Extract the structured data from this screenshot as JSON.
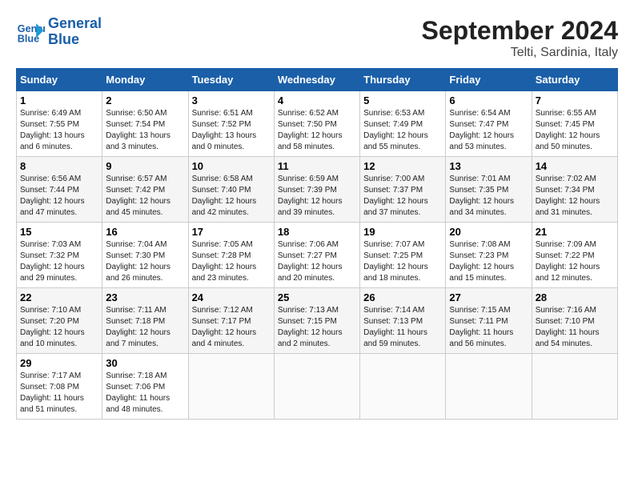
{
  "header": {
    "logo_line1": "General",
    "logo_line2": "Blue",
    "month": "September 2024",
    "location": "Telti, Sardinia, Italy"
  },
  "columns": [
    "Sunday",
    "Monday",
    "Tuesday",
    "Wednesday",
    "Thursday",
    "Friday",
    "Saturday"
  ],
  "weeks": [
    [
      {
        "day": "1",
        "sunrise": "Sunrise: 6:49 AM",
        "sunset": "Sunset: 7:55 PM",
        "daylight": "Daylight: 13 hours and 6 minutes."
      },
      {
        "day": "2",
        "sunrise": "Sunrise: 6:50 AM",
        "sunset": "Sunset: 7:54 PM",
        "daylight": "Daylight: 13 hours and 3 minutes."
      },
      {
        "day": "3",
        "sunrise": "Sunrise: 6:51 AM",
        "sunset": "Sunset: 7:52 PM",
        "daylight": "Daylight: 13 hours and 0 minutes."
      },
      {
        "day": "4",
        "sunrise": "Sunrise: 6:52 AM",
        "sunset": "Sunset: 7:50 PM",
        "daylight": "Daylight: 12 hours and 58 minutes."
      },
      {
        "day": "5",
        "sunrise": "Sunrise: 6:53 AM",
        "sunset": "Sunset: 7:49 PM",
        "daylight": "Daylight: 12 hours and 55 minutes."
      },
      {
        "day": "6",
        "sunrise": "Sunrise: 6:54 AM",
        "sunset": "Sunset: 7:47 PM",
        "daylight": "Daylight: 12 hours and 53 minutes."
      },
      {
        "day": "7",
        "sunrise": "Sunrise: 6:55 AM",
        "sunset": "Sunset: 7:45 PM",
        "daylight": "Daylight: 12 hours and 50 minutes."
      }
    ],
    [
      {
        "day": "8",
        "sunrise": "Sunrise: 6:56 AM",
        "sunset": "Sunset: 7:44 PM",
        "daylight": "Daylight: 12 hours and 47 minutes."
      },
      {
        "day": "9",
        "sunrise": "Sunrise: 6:57 AM",
        "sunset": "Sunset: 7:42 PM",
        "daylight": "Daylight: 12 hours and 45 minutes."
      },
      {
        "day": "10",
        "sunrise": "Sunrise: 6:58 AM",
        "sunset": "Sunset: 7:40 PM",
        "daylight": "Daylight: 12 hours and 42 minutes."
      },
      {
        "day": "11",
        "sunrise": "Sunrise: 6:59 AM",
        "sunset": "Sunset: 7:39 PM",
        "daylight": "Daylight: 12 hours and 39 minutes."
      },
      {
        "day": "12",
        "sunrise": "Sunrise: 7:00 AM",
        "sunset": "Sunset: 7:37 PM",
        "daylight": "Daylight: 12 hours and 37 minutes."
      },
      {
        "day": "13",
        "sunrise": "Sunrise: 7:01 AM",
        "sunset": "Sunset: 7:35 PM",
        "daylight": "Daylight: 12 hours and 34 minutes."
      },
      {
        "day": "14",
        "sunrise": "Sunrise: 7:02 AM",
        "sunset": "Sunset: 7:34 PM",
        "daylight": "Daylight: 12 hours and 31 minutes."
      }
    ],
    [
      {
        "day": "15",
        "sunrise": "Sunrise: 7:03 AM",
        "sunset": "Sunset: 7:32 PM",
        "daylight": "Daylight: 12 hours and 29 minutes."
      },
      {
        "day": "16",
        "sunrise": "Sunrise: 7:04 AM",
        "sunset": "Sunset: 7:30 PM",
        "daylight": "Daylight: 12 hours and 26 minutes."
      },
      {
        "day": "17",
        "sunrise": "Sunrise: 7:05 AM",
        "sunset": "Sunset: 7:28 PM",
        "daylight": "Daylight: 12 hours and 23 minutes."
      },
      {
        "day": "18",
        "sunrise": "Sunrise: 7:06 AM",
        "sunset": "Sunset: 7:27 PM",
        "daylight": "Daylight: 12 hours and 20 minutes."
      },
      {
        "day": "19",
        "sunrise": "Sunrise: 7:07 AM",
        "sunset": "Sunset: 7:25 PM",
        "daylight": "Daylight: 12 hours and 18 minutes."
      },
      {
        "day": "20",
        "sunrise": "Sunrise: 7:08 AM",
        "sunset": "Sunset: 7:23 PM",
        "daylight": "Daylight: 12 hours and 15 minutes."
      },
      {
        "day": "21",
        "sunrise": "Sunrise: 7:09 AM",
        "sunset": "Sunset: 7:22 PM",
        "daylight": "Daylight: 12 hours and 12 minutes."
      }
    ],
    [
      {
        "day": "22",
        "sunrise": "Sunrise: 7:10 AM",
        "sunset": "Sunset: 7:20 PM",
        "daylight": "Daylight: 12 hours and 10 minutes."
      },
      {
        "day": "23",
        "sunrise": "Sunrise: 7:11 AM",
        "sunset": "Sunset: 7:18 PM",
        "daylight": "Daylight: 12 hours and 7 minutes."
      },
      {
        "day": "24",
        "sunrise": "Sunrise: 7:12 AM",
        "sunset": "Sunset: 7:17 PM",
        "daylight": "Daylight: 12 hours and 4 minutes."
      },
      {
        "day": "25",
        "sunrise": "Sunrise: 7:13 AM",
        "sunset": "Sunset: 7:15 PM",
        "daylight": "Daylight: 12 hours and 2 minutes."
      },
      {
        "day": "26",
        "sunrise": "Sunrise: 7:14 AM",
        "sunset": "Sunset: 7:13 PM",
        "daylight": "Daylight: 11 hours and 59 minutes."
      },
      {
        "day": "27",
        "sunrise": "Sunrise: 7:15 AM",
        "sunset": "Sunset: 7:11 PM",
        "daylight": "Daylight: 11 hours and 56 minutes."
      },
      {
        "day": "28",
        "sunrise": "Sunrise: 7:16 AM",
        "sunset": "Sunset: 7:10 PM",
        "daylight": "Daylight: 11 hours and 54 minutes."
      }
    ],
    [
      {
        "day": "29",
        "sunrise": "Sunrise: 7:17 AM",
        "sunset": "Sunset: 7:08 PM",
        "daylight": "Daylight: 11 hours and 51 minutes."
      },
      {
        "day": "30",
        "sunrise": "Sunrise: 7:18 AM",
        "sunset": "Sunset: 7:06 PM",
        "daylight": "Daylight: 11 hours and 48 minutes."
      },
      null,
      null,
      null,
      null,
      null
    ]
  ]
}
